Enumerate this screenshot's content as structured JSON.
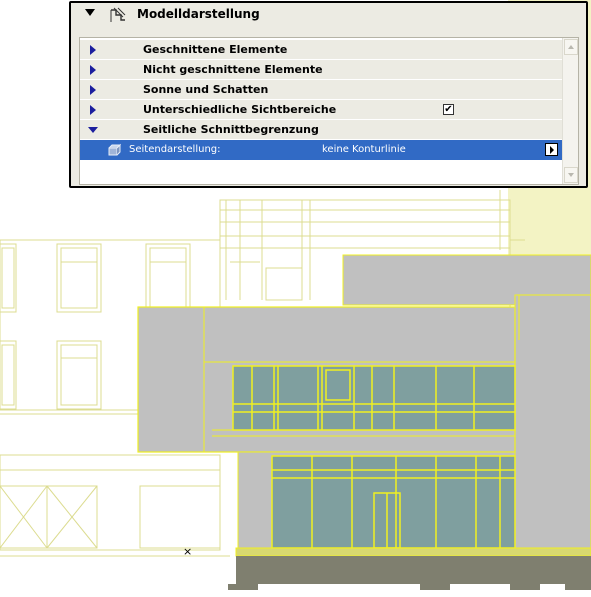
{
  "panel": {
    "title": "Modelldarstellung",
    "header_icon": "model-display-icon",
    "sections": [
      {
        "label": "Geschnittene Elemente",
        "expanded": false
      },
      {
        "label": "Nicht geschnittene Elemente",
        "expanded": false
      },
      {
        "label": "Sonne und Schatten",
        "expanded": false
      },
      {
        "label": "Unterschiedliche Sichtbereiche",
        "expanded": false,
        "checked": true,
        "check_mark": "✔"
      },
      {
        "label": "Seitliche Schnittbegrenzung",
        "expanded": true
      }
    ],
    "selected_row": {
      "icon": "side-display-icon",
      "label": "Seitendarstellung:",
      "value": "keine Konturlinie"
    }
  },
  "drawing": {
    "cursor_mark": "×",
    "colors": {
      "outline": "#d9d97a",
      "highlight": "#f0f020",
      "solid_gray": "#c0c0c0",
      "glass": "#7f9f9f",
      "ground": "#7f7f6f",
      "shaded_area": "#f3f3c4"
    }
  }
}
